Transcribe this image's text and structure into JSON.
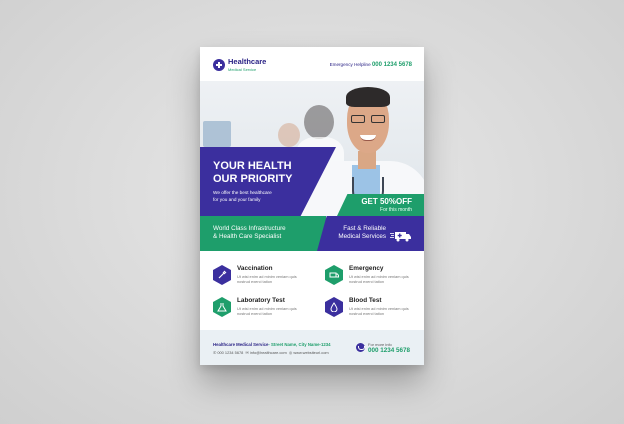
{
  "header": {
    "brand": "Healthcare",
    "brand_sub": "Medical Service",
    "helpline_label": "Emergency Helpline",
    "helpline_number": "000 1234 5678"
  },
  "hero": {
    "title_line1": "YOUR HEALTH",
    "title_line2": "OUR PRIORITY",
    "subtitle_line1": "We offer the best healthcare",
    "subtitle_line2": "for you and your family",
    "offer_main": "GET 50%OFF",
    "offer_sub": "For this month"
  },
  "strip": {
    "left_line1": "World Class Infrastructure",
    "left_line2": "& Health Care Specialist",
    "right_line1": "Fast & Reliable",
    "right_line2": "Medical Services"
  },
  "services": [
    {
      "title": "Vaccination",
      "desc": "Ut wisi enim ad minim veniam quis nostrud exerci tation",
      "icon": "syringe-icon"
    },
    {
      "title": "Emergency",
      "desc": "Ut wisi enim ad minim veniam quis nostrud exerci tation",
      "icon": "ambulance-icon"
    },
    {
      "title": "Laboratory Test",
      "desc": "Ut wisi enim ad minim veniam quis nostrud exerci tation",
      "icon": "flask-icon"
    },
    {
      "title": "Blood Test",
      "desc": "Ut wisi enim ad minim veniam quis nostrud exerci tation",
      "icon": "blood-drop-icon"
    }
  ],
  "footer": {
    "name": "Healthcare Medical Service",
    "address": "- Street Name, City Name-1234",
    "phone": "000 1234 5678",
    "email": "info@healthcare.com",
    "website": "www.websiteurl.com",
    "more_label": "For more info",
    "more_phone": "000 1234 5678"
  },
  "colors": {
    "primary_blue": "#3b2f9e",
    "primary_green": "#1e9e6b"
  }
}
